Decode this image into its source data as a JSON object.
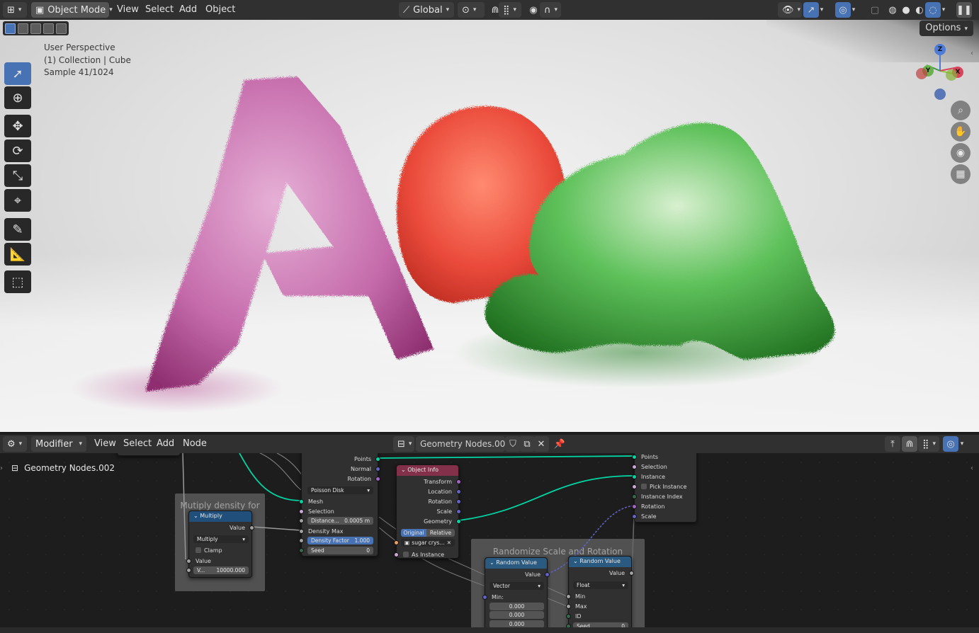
{
  "viewport_header": {
    "editor_icon": "viewport-editor-icon",
    "mode": "Object Mode",
    "menus": [
      "View",
      "Select",
      "Add",
      "Object"
    ],
    "transform_orientation": "Global",
    "options_label": "Options"
  },
  "overlay": {
    "line1": "User Perspective",
    "line2": "(1) Collection | Cube",
    "line3": "Sample 41/1024"
  },
  "gizmo": {
    "x": "X",
    "y": "Y",
    "z": "Z"
  },
  "node_header": {
    "editor_icon": "node-editor-icon",
    "type": "Modifier",
    "menus": [
      "View",
      "Select",
      "Add",
      "Node"
    ],
    "tree_name": "Geometry Nodes.002"
  },
  "breadcrumb": "Geometry Nodes.002",
  "frames": {
    "multiply": "Mutiply density for small scale",
    "randomize": "Randomize Scale and Rotation"
  },
  "nodes": {
    "distribute": {
      "outputs": [
        "Points",
        "Normal",
        "Rotation"
      ],
      "mode": "Poisson Disk",
      "inputs": [
        "Mesh",
        "Selection"
      ],
      "distance_label": "Distance...",
      "distance_value": "0.0005 m",
      "density_max": "Density Max",
      "density_factor_label": "Density Factor",
      "density_factor_value": "1.000",
      "seed_label": "Seed",
      "seed_value": "0"
    },
    "multiply": {
      "title": "Multiply",
      "out": "Value",
      "op": "Multiply",
      "clamp": "Clamp",
      "in": "Value",
      "val_label": "V...",
      "val": "10000.000"
    },
    "object_info": {
      "title": "Object Info",
      "outputs": [
        "Transform",
        "Location",
        "Rotation",
        "Scale",
        "Geometry"
      ],
      "tab_original": "Original",
      "tab_relative": "Relative",
      "object": "sugar crys...",
      "as_instance": "As Instance"
    },
    "instance": {
      "inputs": [
        "Points",
        "Selection",
        "Instance",
        "Pick Instance",
        "Instance Index",
        "Rotation",
        "Scale"
      ]
    },
    "random_vec": {
      "title": "Random Value",
      "out": "Value",
      "type": "Vector",
      "min": "Min:",
      "v1": "0.000",
      "v2": "0.000",
      "v3": "0.000"
    },
    "random_flt": {
      "title": "Random Value",
      "out": "Value",
      "type": "Float",
      "min": "Min",
      "max": "Max",
      "id": "ID",
      "seed_label": "Seed",
      "seed_value": "0"
    }
  },
  "colors": {
    "accent": "#4772b3",
    "geometry_socket": "#00d6a3",
    "letter_a_left": "#c46aa8",
    "red_shape": "#e0483a",
    "green_shape": "#3aa23a"
  }
}
